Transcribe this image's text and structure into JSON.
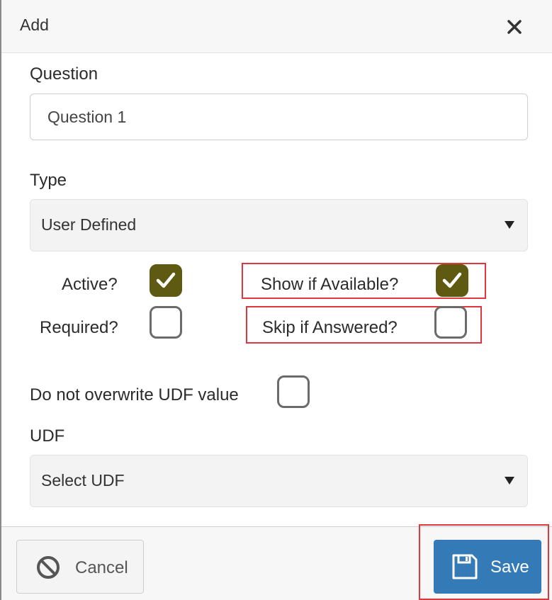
{
  "dialog": {
    "title": "Add"
  },
  "question": {
    "label": "Question",
    "value": "Question 1"
  },
  "type": {
    "label": "Type",
    "selected": "User Defined"
  },
  "checkboxes": {
    "active": {
      "label": "Active?",
      "checked": true
    },
    "required": {
      "label": "Required?",
      "checked": false
    },
    "show_if_available": {
      "label": "Show if Available?",
      "checked": true
    },
    "skip_if_answered": {
      "label": "Skip if Answered?",
      "checked": false
    },
    "do_not_overwrite": {
      "label": "Do not overwrite UDF value",
      "checked": false
    }
  },
  "udf": {
    "label": "UDF",
    "selected": "Select UDF"
  },
  "footer": {
    "cancel_label": "Cancel",
    "save_label": "Save"
  },
  "colors": {
    "checkbox_checked": "#5e5a12",
    "save_button": "#337ab7",
    "highlight": "#e0373f"
  },
  "icons": {
    "close": "close-icon",
    "cancel": "ban-icon",
    "save": "floppy-disk-icon",
    "check": "checkmark-icon",
    "dropdown": "caret-down-icon"
  }
}
